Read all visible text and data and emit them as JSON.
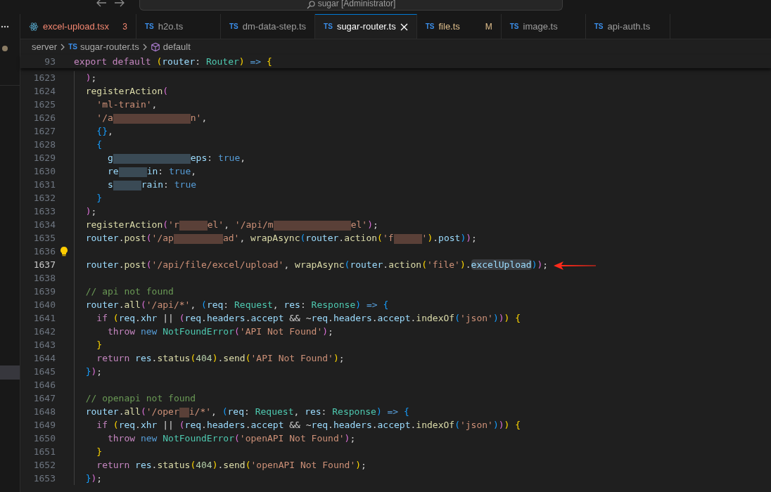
{
  "title_bar": {
    "search": {
      "placeholder": "sugar [Administrator]"
    }
  },
  "tabs": [
    {
      "label": "excel-upload.tsx",
      "kind": "react",
      "error": true,
      "modified": false,
      "badge": "3",
      "selected": false
    },
    {
      "label": "h2o.ts",
      "kind": "ts",
      "type_label": "TS",
      "error": false,
      "modified": false,
      "selected": false
    },
    {
      "label": "dm-data-step.ts",
      "kind": "ts",
      "type_label": "TS",
      "error": false,
      "modified": false,
      "selected": false
    },
    {
      "label": "sugar-router.ts",
      "kind": "ts",
      "type_label": "TS",
      "error": false,
      "modified": false,
      "selected": true
    },
    {
      "label": "file.ts",
      "kind": "ts",
      "type_label": "TS",
      "error": false,
      "modified": true,
      "badge": "M",
      "selected": false
    },
    {
      "label": "image.ts",
      "kind": "ts",
      "type_label": "TS",
      "error": false,
      "modified": false,
      "selected": false
    },
    {
      "label": "api-auth.ts",
      "kind": "ts",
      "type_label": "TS",
      "error": false,
      "modified": false,
      "selected": false
    }
  ],
  "breadcrumb": [
    {
      "label": "server",
      "kind": "folder"
    },
    {
      "label": "sugar-router.ts",
      "kind": "ts",
      "type_label": "TS"
    },
    {
      "label": "default",
      "kind": "symbol"
    }
  ],
  "sticky_line": {
    "number": "93",
    "tokens": [
      {
        "kind": "kw",
        "text": "export"
      },
      {
        "kind": "kw",
        "text": " default"
      },
      {
        "kind": "b1",
        "text": " ("
      },
      {
        "kind": "var",
        "text": "router"
      },
      {
        "kind": "p",
        "text": ":"
      },
      {
        "kind": "ty",
        "text": " Router"
      },
      {
        "kind": "b1",
        "text": ")"
      },
      {
        "kind": "bl",
        "text": " =>"
      },
      {
        "kind": "b1",
        "text": " {"
      }
    ]
  },
  "lines": [
    {
      "number": "1623",
      "current": false,
      "tokens": [
        {
          "kind": "b2",
          "text": "  )"
        },
        {
          "kind": "p",
          "text": ";"
        }
      ]
    },
    {
      "number": "1624",
      "current": false,
      "tokens": [
        {
          "kind": "fn",
          "text": "  registerAction"
        },
        {
          "kind": "b2",
          "text": "("
        }
      ]
    },
    {
      "number": "1625",
      "current": false,
      "tokens": [
        {
          "kind": "st",
          "text": "    'ml-train'"
        },
        {
          "kind": "p",
          "text": ","
        }
      ]
    },
    {
      "number": "1626",
      "current": false,
      "tokens": [
        {
          "kind": "st",
          "text": "    '/a"
        },
        {
          "kind": "blur_str_l"
        },
        {
          "kind": "st",
          "text": "n'"
        },
        {
          "kind": "p",
          "text": ","
        }
      ]
    },
    {
      "number": "1627",
      "current": false,
      "tokens": [
        {
          "kind": "b3",
          "text": "    {}"
        },
        {
          "kind": "p",
          "text": ","
        }
      ]
    },
    {
      "number": "1628",
      "current": false,
      "tokens": [
        {
          "kind": "b3",
          "text": "    {"
        }
      ]
    },
    {
      "number": "1629",
      "current": false,
      "tokens": [
        {
          "kind": "var",
          "text": "      g"
        },
        {
          "kind": "blur_name_l"
        },
        {
          "kind": "var",
          "text": "eps"
        },
        {
          "kind": "p",
          "text": ":"
        },
        {
          "kind": "bl",
          "text": " true"
        },
        {
          "kind": "p",
          "text": ","
        }
      ]
    },
    {
      "number": "1630",
      "current": false,
      "tokens": [
        {
          "kind": "var",
          "text": "      re"
        },
        {
          "kind": "blur_name_s"
        },
        {
          "kind": "var",
          "text": "in"
        },
        {
          "kind": "p",
          "text": ":"
        },
        {
          "kind": "bl",
          "text": " true"
        },
        {
          "kind": "p",
          "text": ","
        }
      ]
    },
    {
      "number": "1631",
      "current": false,
      "tokens": [
        {
          "kind": "var",
          "text": "      s"
        },
        {
          "kind": "blur_name_s"
        },
        {
          "kind": "var",
          "text": "rain"
        },
        {
          "kind": "p",
          "text": ":"
        },
        {
          "kind": "bl",
          "text": " true"
        }
      ]
    },
    {
      "number": "1632",
      "current": false,
      "tokens": [
        {
          "kind": "b3",
          "text": "    }"
        }
      ]
    },
    {
      "number": "1633",
      "current": false,
      "tokens": [
        {
          "kind": "b2",
          "text": "  )"
        },
        {
          "kind": "p",
          "text": ";"
        }
      ]
    },
    {
      "number": "1634",
      "current": false,
      "tokens": [
        {
          "kind": "fn",
          "text": "  registerAction"
        },
        {
          "kind": "b2",
          "text": "("
        },
        {
          "kind": "st",
          "text": "'r"
        },
        {
          "kind": "blur_str_s"
        },
        {
          "kind": "st",
          "text": "el'"
        },
        {
          "kind": "p",
          "text": ","
        },
        {
          "kind": "st",
          "text": " '/api/m"
        },
        {
          "kind": "blur_str_l"
        },
        {
          "kind": "st",
          "text": "el'"
        },
        {
          "kind": "b2",
          "text": ")"
        },
        {
          "kind": "p",
          "text": ";"
        }
      ]
    },
    {
      "number": "1635",
      "current": false,
      "tokens": [
        {
          "kind": "var",
          "text": "  router"
        },
        {
          "kind": "p",
          "text": "."
        },
        {
          "kind": "fn",
          "text": "post"
        },
        {
          "kind": "b2",
          "text": "("
        },
        {
          "kind": "st",
          "text": "'/ap"
        },
        {
          "kind": "blur_str_m"
        },
        {
          "kind": "st",
          "text": "ad'"
        },
        {
          "kind": "p",
          "text": ","
        },
        {
          "kind": "fn",
          "text": " wrapAsync"
        },
        {
          "kind": "b3",
          "text": "("
        },
        {
          "kind": "var",
          "text": "router"
        },
        {
          "kind": "p",
          "text": "."
        },
        {
          "kind": "fn",
          "text": "action"
        },
        {
          "kind": "b1",
          "text": "("
        },
        {
          "kind": "st",
          "text": "'f"
        },
        {
          "kind": "blur_str_s"
        },
        {
          "kind": "st",
          "text": "'"
        },
        {
          "kind": "b1",
          "text": ")"
        },
        {
          "kind": "p",
          "text": "."
        },
        {
          "kind": "var",
          "text": "post"
        },
        {
          "kind": "b3",
          "text": ")"
        },
        {
          "kind": "b2",
          "text": ")"
        },
        {
          "kind": "p",
          "text": ";"
        }
      ]
    },
    {
      "number": "1636",
      "current": false,
      "tokens": [
        {
          "kind": "lightbulb"
        }
      ]
    },
    {
      "number": "1637",
      "current": true,
      "tokens": [
        {
          "kind": "var",
          "text": "  router"
        },
        {
          "kind": "p",
          "text": "."
        },
        {
          "kind": "fn",
          "text": "post"
        },
        {
          "kind": "b2",
          "text": "("
        },
        {
          "kind": "st",
          "text": "'/api/file/excel/upload'"
        },
        {
          "kind": "p",
          "text": ","
        },
        {
          "kind": "fn",
          "text": " wrapAsync"
        },
        {
          "kind": "b3",
          "text": "("
        },
        {
          "kind": "var",
          "text": "router"
        },
        {
          "kind": "p",
          "text": "."
        },
        {
          "kind": "fn",
          "text": "action"
        },
        {
          "kind": "b1",
          "text": "("
        },
        {
          "kind": "st",
          "text": "'file'"
        },
        {
          "kind": "b1",
          "text": ")"
        },
        {
          "kind": "p",
          "text": "."
        },
        {
          "kind": "hl",
          "text": "excelUpload"
        },
        {
          "kind": "b3",
          "text": ")"
        },
        {
          "kind": "b2",
          "text": ")"
        },
        {
          "kind": "p",
          "text": ";"
        },
        {
          "kind": "arrow"
        }
      ]
    },
    {
      "number": "1638",
      "current": false
    },
    {
      "number": "1639",
      "current": false,
      "tokens": [
        {
          "kind": "cm",
          "text": "  // api not found"
        }
      ]
    },
    {
      "number": "1640",
      "current": false,
      "tokens": [
        {
          "kind": "var",
          "text": "  router"
        },
        {
          "kind": "p",
          "text": "."
        },
        {
          "kind": "fn",
          "text": "all"
        },
        {
          "kind": "b2",
          "text": "("
        },
        {
          "kind": "st",
          "text": "'/api/*'"
        },
        {
          "kind": "p",
          "text": ","
        },
        {
          "kind": "b3",
          "text": " ("
        },
        {
          "kind": "var",
          "text": "req"
        },
        {
          "kind": "p",
          "text": ":"
        },
        {
          "kind": "ty",
          "text": " Request"
        },
        {
          "kind": "p",
          "text": ","
        },
        {
          "kind": "var",
          "text": " res"
        },
        {
          "kind": "p",
          "text": ":"
        },
        {
          "kind": "ty",
          "text": " Response"
        },
        {
          "kind": "b3",
          "text": ")"
        },
        {
          "kind": "bl",
          "text": " =>"
        },
        {
          "kind": "b3",
          "text": " {"
        }
      ]
    },
    {
      "number": "1641",
      "current": false,
      "tokens": [
        {
          "kind": "kw",
          "text": "    if"
        },
        {
          "kind": "b1",
          "text": " ("
        },
        {
          "kind": "var",
          "text": "req"
        },
        {
          "kind": "p",
          "text": "."
        },
        {
          "kind": "var",
          "text": "xhr"
        },
        {
          "kind": "p",
          "text": " ||"
        },
        {
          "kind": "b2",
          "text": " ("
        },
        {
          "kind": "var",
          "text": "req"
        },
        {
          "kind": "p",
          "text": "."
        },
        {
          "kind": "var",
          "text": "headers"
        },
        {
          "kind": "p",
          "text": "."
        },
        {
          "kind": "var",
          "text": "accept"
        },
        {
          "kind": "p",
          "text": " && ~"
        },
        {
          "kind": "var",
          "text": "req"
        },
        {
          "kind": "p",
          "text": "."
        },
        {
          "kind": "var",
          "text": "headers"
        },
        {
          "kind": "p",
          "text": "."
        },
        {
          "kind": "var",
          "text": "accept"
        },
        {
          "kind": "p",
          "text": "."
        },
        {
          "kind": "fn",
          "text": "indexOf"
        },
        {
          "kind": "b3",
          "text": "("
        },
        {
          "kind": "st",
          "text": "'json'"
        },
        {
          "kind": "b3",
          "text": ")"
        },
        {
          "kind": "b2",
          "text": ")"
        },
        {
          "kind": "b1",
          "text": ")"
        },
        {
          "kind": "b1",
          "text": " {"
        }
      ]
    },
    {
      "number": "1642",
      "current": false,
      "tokens": [
        {
          "kind": "kw",
          "text": "      throw"
        },
        {
          "kind": "bl",
          "text": " new"
        },
        {
          "kind": "ty",
          "text": " NotFoundError"
        },
        {
          "kind": "b2",
          "text": "("
        },
        {
          "kind": "st",
          "text": "'API Not Found'"
        },
        {
          "kind": "b2",
          "text": ")"
        },
        {
          "kind": "p",
          "text": ";"
        }
      ]
    },
    {
      "number": "1643",
      "current": false,
      "tokens": [
        {
          "kind": "b1",
          "text": "    }"
        }
      ]
    },
    {
      "number": "1644",
      "current": false,
      "tokens": [
        {
          "kind": "kw",
          "text": "    return"
        },
        {
          "kind": "var",
          "text": " res"
        },
        {
          "kind": "p",
          "text": "."
        },
        {
          "kind": "fn",
          "text": "status"
        },
        {
          "kind": "b1",
          "text": "("
        },
        {
          "kind": "num",
          "text": "404"
        },
        {
          "kind": "b1",
          "text": ")"
        },
        {
          "kind": "p",
          "text": "."
        },
        {
          "kind": "fn",
          "text": "send"
        },
        {
          "kind": "b1",
          "text": "("
        },
        {
          "kind": "st",
          "text": "'API Not Found'"
        },
        {
          "kind": "b1",
          "text": ")"
        },
        {
          "kind": "p",
          "text": ";"
        }
      ]
    },
    {
      "number": "1645",
      "current": false,
      "tokens": [
        {
          "kind": "b3",
          "text": "  }"
        },
        {
          "kind": "b2",
          "text": ")"
        },
        {
          "kind": "p",
          "text": ";"
        }
      ]
    },
    {
      "number": "1646",
      "current": false
    },
    {
      "number": "1647",
      "current": false,
      "tokens": [
        {
          "kind": "cm",
          "text": "  // openapi not found"
        }
      ]
    },
    {
      "number": "1648",
      "current": false,
      "tokens": [
        {
          "kind": "var",
          "text": "  router"
        },
        {
          "kind": "p",
          "text": "."
        },
        {
          "kind": "fn",
          "text": "all"
        },
        {
          "kind": "b2",
          "text": "("
        },
        {
          "kind": "st",
          "text": "'/oper"
        },
        {
          "kind": "blur_str_xs"
        },
        {
          "kind": "st",
          "text": "i/*'"
        },
        {
          "kind": "p",
          "text": ","
        },
        {
          "kind": "b3",
          "text": " ("
        },
        {
          "kind": "var",
          "text": "req"
        },
        {
          "kind": "p",
          "text": ":"
        },
        {
          "kind": "ty",
          "text": " Request"
        },
        {
          "kind": "p",
          "text": ","
        },
        {
          "kind": "var",
          "text": " res"
        },
        {
          "kind": "p",
          "text": ":"
        },
        {
          "kind": "ty",
          "text": " Response"
        },
        {
          "kind": "b3",
          "text": ")"
        },
        {
          "kind": "bl",
          "text": " =>"
        },
        {
          "kind": "b3",
          "text": " {"
        }
      ]
    },
    {
      "number": "1649",
      "current": false,
      "tokens": [
        {
          "kind": "kw",
          "text": "    if"
        },
        {
          "kind": "b1",
          "text": " ("
        },
        {
          "kind": "var",
          "text": "req"
        },
        {
          "kind": "p",
          "text": "."
        },
        {
          "kind": "var",
          "text": "xhr"
        },
        {
          "kind": "p",
          "text": " ||"
        },
        {
          "kind": "b2",
          "text": " ("
        },
        {
          "kind": "var",
          "text": "req"
        },
        {
          "kind": "p",
          "text": "."
        },
        {
          "kind": "var",
          "text": "headers"
        },
        {
          "kind": "p",
          "text": "."
        },
        {
          "kind": "var",
          "text": "accept"
        },
        {
          "kind": "p",
          "text": " && ~"
        },
        {
          "kind": "var",
          "text": "req"
        },
        {
          "kind": "p",
          "text": "."
        },
        {
          "kind": "var",
          "text": "headers"
        },
        {
          "kind": "p",
          "text": "."
        },
        {
          "kind": "var",
          "text": "accept"
        },
        {
          "kind": "p",
          "text": "."
        },
        {
          "kind": "fn",
          "text": "indexOf"
        },
        {
          "kind": "b3",
          "text": "("
        },
        {
          "kind": "st",
          "text": "'json'"
        },
        {
          "kind": "b3",
          "text": ")"
        },
        {
          "kind": "b2",
          "text": ")"
        },
        {
          "kind": "b1",
          "text": ")"
        },
        {
          "kind": "b1",
          "text": " {"
        }
      ]
    },
    {
      "number": "1650",
      "current": false,
      "tokens": [
        {
          "kind": "kw",
          "text": "      throw"
        },
        {
          "kind": "bl",
          "text": " new"
        },
        {
          "kind": "ty",
          "text": " NotFoundError"
        },
        {
          "kind": "b2",
          "text": "("
        },
        {
          "kind": "st",
          "text": "'openAPI Not Found'"
        },
        {
          "kind": "b2",
          "text": ")"
        },
        {
          "kind": "p",
          "text": ";"
        }
      ]
    },
    {
      "number": "1651",
      "current": false,
      "tokens": [
        {
          "kind": "b1",
          "text": "    }"
        }
      ]
    },
    {
      "number": "1652",
      "current": false,
      "tokens": [
        {
          "kind": "kw",
          "text": "    return"
        },
        {
          "kind": "var",
          "text": " res"
        },
        {
          "kind": "p",
          "text": "."
        },
        {
          "kind": "fn",
          "text": "status"
        },
        {
          "kind": "b1",
          "text": "("
        },
        {
          "kind": "num",
          "text": "404"
        },
        {
          "kind": "b1",
          "text": ")"
        },
        {
          "kind": "p",
          "text": "."
        },
        {
          "kind": "fn",
          "text": "send"
        },
        {
          "kind": "b1",
          "text": "("
        },
        {
          "kind": "st",
          "text": "'openAPI Not Found'"
        },
        {
          "kind": "b1",
          "text": ")"
        },
        {
          "kind": "p",
          "text": ";"
        }
      ]
    },
    {
      "number": "1653",
      "current": false,
      "tokens": [
        {
          "kind": "b3",
          "text": "  }"
        },
        {
          "kind": "b2",
          "text": ")"
        },
        {
          "kind": "p",
          "text": ";"
        }
      ]
    }
  ]
}
